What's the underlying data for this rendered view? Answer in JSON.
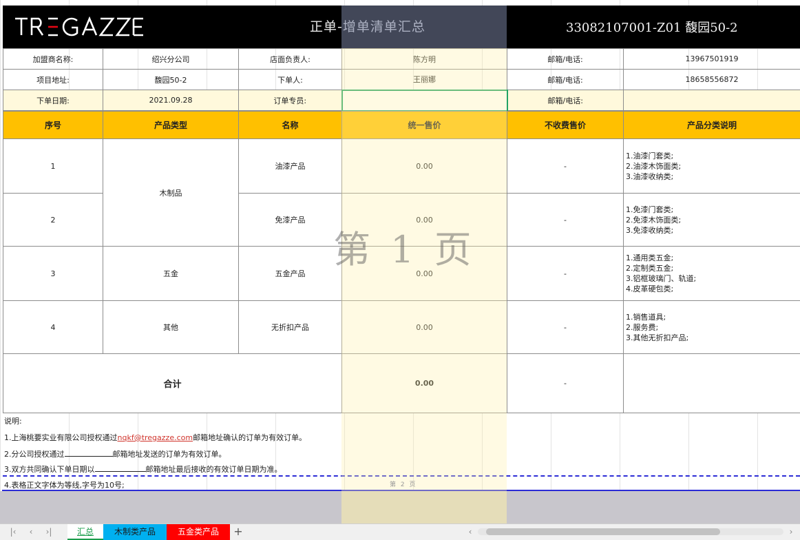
{
  "banner": {
    "logo_text": "TRE GAZZE",
    "title": "正单-增单清单汇总",
    "code": "33082107001-Z01 馥园50-2"
  },
  "info": {
    "rows": [
      {
        "l1": "加盟商名称:",
        "v1": "绍兴分公司",
        "l2": "店面负责人:",
        "v2": "陈方明",
        "l3": "邮箱/电话:",
        "v3": "13967501919"
      },
      {
        "l1": "项目地址:",
        "v1": "馥园50-2",
        "l2": "下单人:",
        "v2": "王丽娜",
        "l3": "邮箱/电话:",
        "v3": "18658556872"
      },
      {
        "l1": "下单日期:",
        "v1": "2021.09.28",
        "l2": "订单专员:",
        "v2": "",
        "l3": "邮箱/电话:",
        "v3": ""
      }
    ]
  },
  "table": {
    "headers": [
      "序号",
      "产品类型",
      "名称",
      "统一售价",
      "不收费售价",
      "产品分类说明"
    ],
    "rows": [
      {
        "no": "1",
        "type": "木制品",
        "name": "油漆产品",
        "price": "0.00",
        "free": "-",
        "desc": [
          "1.油漆门套类;",
          "2.油漆木饰面类;",
          "3.油漆收纳类;"
        ]
      },
      {
        "no": "2",
        "type": "",
        "name": "免漆产品",
        "price": "0.00",
        "free": "-",
        "desc": [
          "1.免漆门套类;",
          "2.免漆木饰面类;",
          "3.免漆收纳类;"
        ]
      },
      {
        "no": "3",
        "type": "五金",
        "name": "五金产品",
        "price": "0.00",
        "free": "-",
        "desc": [
          "1.通用类五金;",
          "2.定制类五金;",
          "3.铝框玻璃门、轨道;",
          "4.皮革硬包类;"
        ]
      },
      {
        "no": "4",
        "type": "其他",
        "name": "无折扣产品",
        "price": "0.00",
        "free": "-",
        "desc": [
          "1.销售道具;",
          "2.服务费;",
          "3.其他无折扣产品;"
        ]
      }
    ],
    "total": {
      "label": "合计",
      "price": "0.00",
      "free": "-"
    }
  },
  "watermark": "第 1 页",
  "page2": "第 2 页",
  "notes": {
    "title": "说明:",
    "n1_pre": "1.上海桃要实业有限公司授权通过",
    "n1_link": "nqkf@tregazze.com",
    "n1_post": "邮箱地址确认的订单为有效订单。",
    "n2_pre": "2.分公司授权通过",
    "n2_post": "邮箱地址发送的订单为有效订单。",
    "n3_pre": "3.双方共同确认下单日期以",
    "n3_post": "邮箱地址最后接收的有效订单日期为准。",
    "n4": "4.表格正文字体为等线,字号为10号;"
  },
  "tabs": {
    "sheets": [
      "汇总",
      "木制类产品",
      "五金类产品"
    ],
    "add": "+",
    "active": "汇总",
    "colors": {
      "wood": "#00b0f0",
      "hardware": "#ff0000",
      "active_text": "#1a9c4a"
    }
  },
  "colors": {
    "header_fill": "#ffc000",
    "info_highlight": "#fff9dc",
    "selection": "#21a366"
  }
}
